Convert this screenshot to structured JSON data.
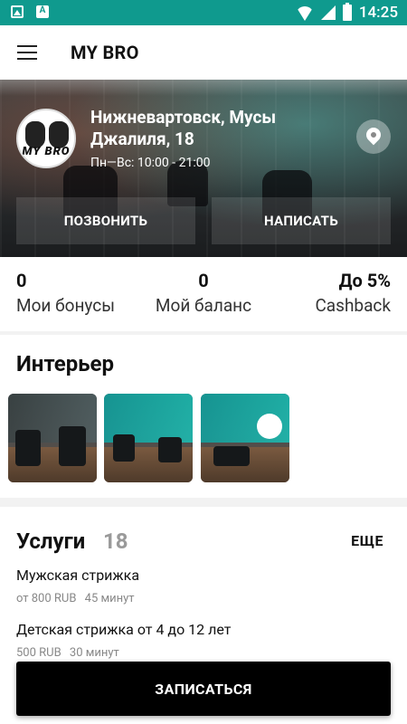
{
  "status_bar": {
    "time": "14:25"
  },
  "app_bar": {
    "title": "MY BRO"
  },
  "hero": {
    "logo_text": "MY BRO",
    "address": "Нижневартовск, Мусы Джалиля, 18",
    "hours": "Пн—Вс: 10:00 - 21:00",
    "call_label": "ПОЗВОНИТЬ",
    "write_label": "НАПИСАТЬ"
  },
  "stats": {
    "bonuses_value": "0",
    "bonuses_label": "Мои бонусы",
    "balance_value": "0",
    "balance_label": "Мой баланс",
    "cashback_value": "До 5%",
    "cashback_label": "Cashback"
  },
  "interior": {
    "title": "Интерьер",
    "photos": [
      "interior-photo-1",
      "interior-photo-2",
      "interior-photo-3"
    ]
  },
  "services": {
    "title": "Услуги",
    "count": "18",
    "more_label": "ЕЩЕ",
    "items": [
      {
        "name": "Мужская стрижка",
        "price": "от 800 RUB",
        "duration": "45 минут"
      },
      {
        "name": "Детская стрижка от 4 до 12 лет",
        "price": "500 RUB",
        "duration": "30 минут"
      }
    ]
  },
  "book_button": {
    "label": "ЗАПИСАТЬСЯ"
  },
  "colors": {
    "status_bar": "#0f9a8e",
    "primary_button": "#000000",
    "muted_text": "#888888"
  }
}
